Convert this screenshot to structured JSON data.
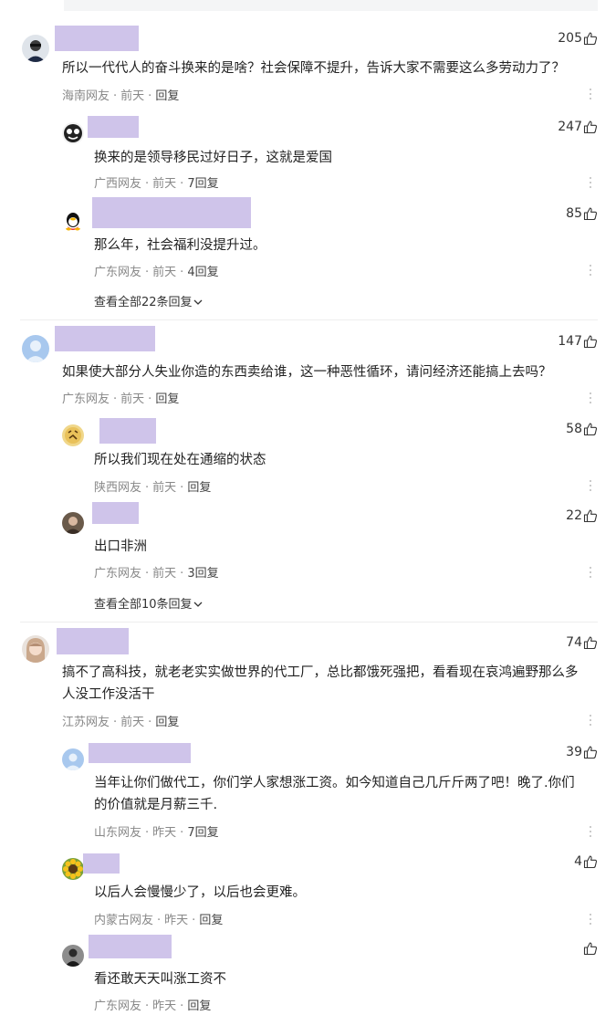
{
  "comments": [
    {
      "likes": "205",
      "text": "所以一代代人的奋斗换来的是啥？社会保障不提升，告诉大家不需要这么多劳动力了？",
      "location": "海南网友",
      "time": "前天",
      "reply": "回复",
      "replies": [
        {
          "likes": "247",
          "text": "换来的是领导移民过好日子，这就是爱国",
          "location": "广西网友",
          "time": "前天",
          "reply": "7回复"
        },
        {
          "likes": "85",
          "text": "那么年，社会福利没提升过。",
          "location": "广东网友",
          "time": "前天",
          "reply": "4回复"
        }
      ],
      "view_all": "查看全部22条回复"
    },
    {
      "likes": "147",
      "text": "如果使大部分人失业你造的东西卖给谁，这一种恶性循环，请问经济还能搞上去吗？",
      "location": "广东网友",
      "time": "前天",
      "reply": "回复",
      "replies": [
        {
          "likes": "58",
          "text": "所以我们现在处在通缩的状态",
          "location": "陕西网友",
          "time": "前天",
          "reply": "回复"
        },
        {
          "likes": "22",
          "text": "出口非洲",
          "location": "广东网友",
          "time": "前天",
          "reply": "3回复"
        }
      ],
      "view_all": "查看全部10条回复"
    },
    {
      "likes": "74",
      "text_line1": "搞不了高科技，就老老实实做世界的代工厂，总比都饿死强把，看看现在哀鸿遍野那么多",
      "text_line2": "人没工作没活干",
      "location": "江苏网友",
      "time": "前天",
      "reply": "回复",
      "replies": [
        {
          "likes": "39",
          "text_line1": "当年让你们做代工，你们学人家想涨工资。如今知道自己几斤斤两了吧！晚了.你们",
          "text_line2": "的价值就是月薪三千.",
          "location": "山东网友",
          "time": "昨天",
          "reply": "7回复"
        },
        {
          "likes": "4",
          "text": "以后人会慢慢少了，以后也会更难。",
          "location": "内蒙古网友",
          "time": "昨天",
          "reply": "回复"
        },
        {
          "likes": "",
          "text": "看还敢天天叫涨工资不",
          "location": "广东网友",
          "time": "昨天",
          "reply": "回复"
        }
      ]
    }
  ],
  "colors": {
    "name_block": "#cfc4ea",
    "meta": "#888888",
    "text": "#222222"
  }
}
